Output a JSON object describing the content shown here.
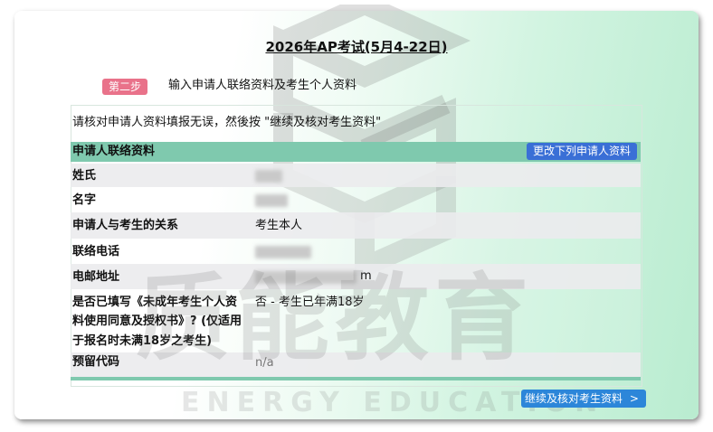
{
  "page": {
    "title": "2026年AP考试(5月4-22日)",
    "step_badge": "第二步",
    "step_text": "输入申请人联络资料及考生个人资料",
    "instruction": "请核对申请人资料填报无误，然後按 \"继续及核对考生资料\""
  },
  "section": {
    "title": "申请人联络资料",
    "edit_button": "更改下列申请人资料"
  },
  "fields": [
    {
      "label": "姓氏",
      "value": ""
    },
    {
      "label": "名字",
      "value": ""
    },
    {
      "label": "申请人与考生的关系",
      "value": "考生本人"
    },
    {
      "label": "联络电话",
      "value": ""
    },
    {
      "label": "电邮地址",
      "value": "m"
    },
    {
      "label_lines": [
        "是否已填写《未成年考生个人资",
        "料使用同意及授权书》? (仅适用",
        "于报名时未满18岁之考生)"
      ],
      "value": "否 - 考生已年满18岁"
    },
    {
      "label": "预留代码",
      "value": "n/a"
    }
  ],
  "footer": {
    "continue_button": "继续及核对考生资料",
    "continue_icon": "chevron-right-icon",
    "continue_glyph": ">"
  },
  "watermark": {
    "text": "质能教育",
    "subtext": "ENERGY EDUCATION"
  },
  "colors": {
    "header_bg": "#7fc9ae",
    "badge_bg": "#e9728a",
    "button_bg": "#3a6fd6"
  }
}
